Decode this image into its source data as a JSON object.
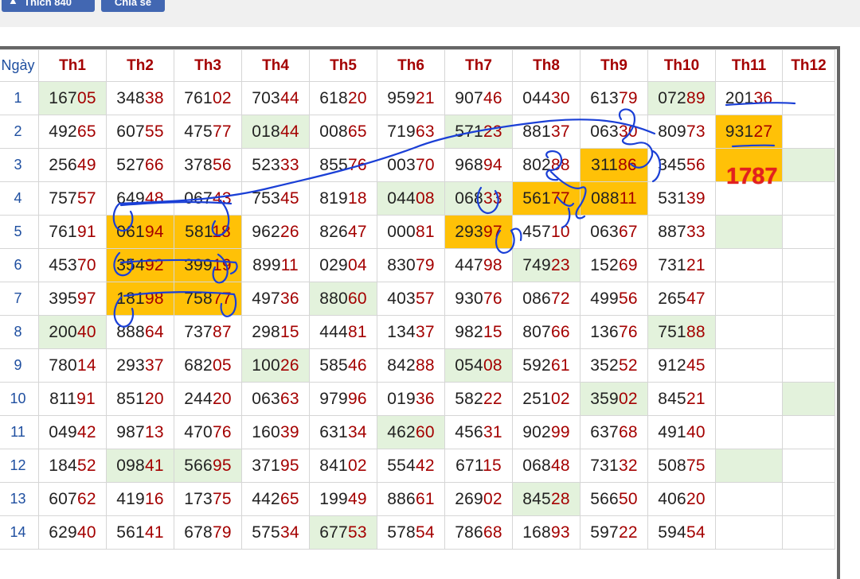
{
  "buttons": {
    "like_label": "Thích 840",
    "share_label": "Chia sẻ"
  },
  "table": {
    "headers": [
      "Ngày",
      "Th1",
      "Th2",
      "Th3",
      "Th4",
      "Th5",
      "Th6",
      "Th7",
      "Th8",
      "Th9",
      "Th10",
      "Th11",
      "Th12"
    ],
    "rows": [
      {
        "day": "1",
        "cells": [
          "16705",
          "34838",
          "76102",
          "70344",
          "61820",
          "95921",
          "90746",
          "04430",
          "61379",
          "07289",
          "20136",
          ""
        ]
      },
      {
        "day": "2",
        "cells": [
          "49265",
          "60755",
          "47577",
          "01844",
          "00865",
          "71963",
          "57123",
          "88137",
          "06330",
          "80973",
          "93127",
          ""
        ]
      },
      {
        "day": "3",
        "cells": [
          "25649",
          "52766",
          "37856",
          "52333",
          "85576",
          "00370",
          "96894",
          "80288",
          "31186",
          "34556",
          "",
          ""
        ]
      },
      {
        "day": "4",
        "cells": [
          "75757",
          "64948",
          "06743",
          "75345",
          "81918",
          "04408",
          "06833",
          "56177",
          "08811",
          "53139",
          "",
          ""
        ]
      },
      {
        "day": "5",
        "cells": [
          "76191",
          "06194",
          "58118",
          "96226",
          "82647",
          "00081",
          "29397",
          "45710",
          "06367",
          "88733",
          "",
          ""
        ]
      },
      {
        "day": "6",
        "cells": [
          "45370",
          "35492",
          "39919",
          "89911",
          "02904",
          "83079",
          "44798",
          "74923",
          "15269",
          "73121",
          "",
          ""
        ]
      },
      {
        "day": "7",
        "cells": [
          "39597",
          "18198",
          "75877",
          "49736",
          "88060",
          "40357",
          "93076",
          "08672",
          "49956",
          "26547",
          "",
          ""
        ]
      },
      {
        "day": "8",
        "cells": [
          "20040",
          "88864",
          "73787",
          "29815",
          "44481",
          "13437",
          "98215",
          "80766",
          "13676",
          "75188",
          "",
          ""
        ]
      },
      {
        "day": "9",
        "cells": [
          "78014",
          "29337",
          "68205",
          "10026",
          "58546",
          "84288",
          "05408",
          "59261",
          "35252",
          "91245",
          "",
          ""
        ]
      },
      {
        "day": "10",
        "cells": [
          "81191",
          "85120",
          "24420",
          "06363",
          "97996",
          "01936",
          "58222",
          "25102",
          "35902",
          "84521",
          "",
          ""
        ]
      },
      {
        "day": "11",
        "cells": [
          "04942",
          "98713",
          "47076",
          "16039",
          "63134",
          "46260",
          "45631",
          "90299",
          "63768",
          "49140",
          "",
          ""
        ]
      },
      {
        "day": "12",
        "cells": [
          "18452",
          "09841",
          "56695",
          "37195",
          "84102",
          "55442",
          "67115",
          "06848",
          "73132",
          "50875",
          "",
          ""
        ]
      },
      {
        "day": "13",
        "cells": [
          "60762",
          "41916",
          "17375",
          "44265",
          "19949",
          "88661",
          "26902",
          "84528",
          "56650",
          "40620",
          "",
          ""
        ]
      },
      {
        "day": "14",
        "cells": [
          "62940",
          "56141",
          "67879",
          "57534",
          "67753",
          "57854",
          "78668",
          "16893",
          "59722",
          "59454",
          "",
          ""
        ]
      }
    ]
  },
  "highlight_orange": [
    [
      1,
      10
    ],
    [
      2,
      8
    ],
    [
      2,
      10
    ],
    [
      3,
      7
    ],
    [
      3,
      8
    ],
    [
      4,
      1
    ],
    [
      4,
      2
    ],
    [
      4,
      6
    ],
    [
      5,
      1
    ],
    [
      5,
      2
    ],
    [
      6,
      1
    ],
    [
      6,
      2
    ]
  ],
  "highlight_green": [
    [
      0,
      0
    ],
    [
      0,
      9
    ],
    [
      1,
      3
    ],
    [
      1,
      6
    ],
    [
      2,
      11
    ],
    [
      3,
      5
    ],
    [
      3,
      6
    ],
    [
      4,
      10
    ],
    [
      5,
      7
    ],
    [
      6,
      4
    ],
    [
      7,
      0
    ],
    [
      7,
      9
    ],
    [
      8,
      3
    ],
    [
      8,
      6
    ],
    [
      9,
      8
    ],
    [
      9,
      11
    ],
    [
      10,
      5
    ],
    [
      11,
      1
    ],
    [
      11,
      2
    ],
    [
      11,
      10
    ],
    [
      12,
      7
    ],
    [
      13,
      4
    ]
  ],
  "annotation": {
    "text": "1787"
  },
  "colors": {
    "orange": "#ffc107",
    "green": "#e3f2dc",
    "header": "#a40000",
    "day": "#1f4fa0",
    "ink": "#1a3fd6"
  }
}
